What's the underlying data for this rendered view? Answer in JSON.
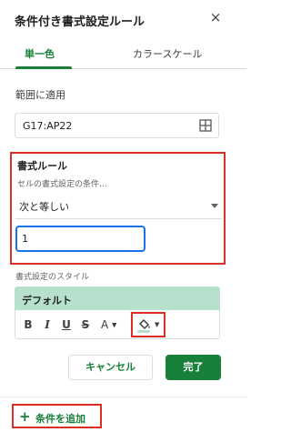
{
  "panel": {
    "title": "条件付き書式設定ルール",
    "close_label": "×"
  },
  "tabs": [
    {
      "label": "単一色",
      "active": true
    },
    {
      "label": "カラースケール",
      "active": false
    }
  ],
  "range": {
    "label": "範囲に適用",
    "value": "G17:AP22",
    "icon": "grid-select-icon"
  },
  "rules": {
    "label": "書式ルール",
    "condition_label": "セルの書式設定の条件…",
    "condition_value": "次と等しい",
    "input_value": "1"
  },
  "style": {
    "label": "書式設定のスタイル",
    "preview_text": "デフォルト",
    "preview_color": "#b7e1cd",
    "buttons": {
      "bold": "B",
      "italic": "I",
      "underline": "U",
      "strikethrough": "S",
      "text_color": "A",
      "fill_icon": "fill-color-icon"
    }
  },
  "actions": {
    "cancel": "キャンセル",
    "done": "完了"
  },
  "add_rule": {
    "plus": "+",
    "label": "条件を追加"
  },
  "colors": {
    "accent": "#188038",
    "highlight": "#d93025",
    "focus": "#1a73e8"
  }
}
